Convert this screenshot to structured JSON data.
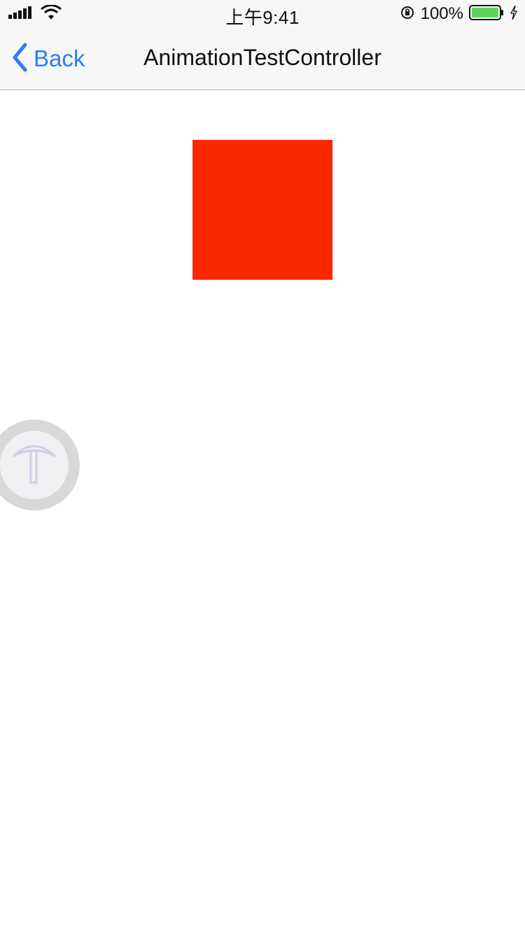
{
  "status_bar": {
    "time": "上午9:41",
    "battery_percent": "100%",
    "battery_color": "#5ed45a",
    "icons": [
      "signal-icon",
      "wifi-icon",
      "orientation-lock-icon",
      "battery-icon",
      "charging-icon"
    ]
  },
  "nav": {
    "back_label": "Back",
    "title": "AnimationTestController",
    "tint_color": "#2f7cf6"
  },
  "content": {
    "square_color": "#f82800",
    "assistive_touch_icon": "pickaxe-icon"
  }
}
